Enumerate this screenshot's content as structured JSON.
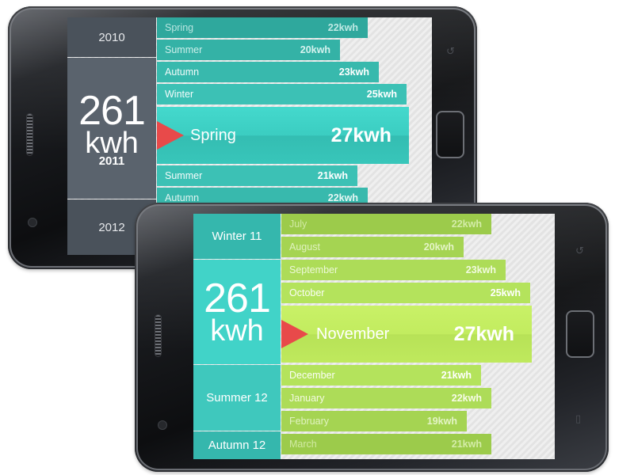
{
  "phone1": {
    "years": [
      {
        "label": "2010"
      },
      {
        "label": "2012"
      }
    ],
    "total": {
      "number": "261",
      "unit": "kwh",
      "year": "2011"
    },
    "bars": [
      {
        "label": "Spring",
        "value": "22kwh",
        "fraction": 0.6
      },
      {
        "label": "Summer",
        "value": "20kwh",
        "fraction": 0.52
      },
      {
        "label": "Autumn",
        "value": "23kwh",
        "fraction": 0.63
      },
      {
        "label": "Winter",
        "value": "25kwh",
        "fraction": 0.71
      },
      {
        "label": "Summer",
        "value": "21kwh",
        "fraction": 0.57
      },
      {
        "label": "Autumn",
        "value": "22kwh",
        "fraction": 0.6
      }
    ],
    "selected": {
      "label": "Spring",
      "value": "27kwh"
    },
    "colors": {
      "bar": "#3cbcb0",
      "bar_text": "#ffffff",
      "selected": "#3fd5c9",
      "year_bg": "#4a525b",
      "total_bg": "#5a636d",
      "marker": "#e84a4a"
    }
  },
  "phone2": {
    "seasons": [
      {
        "label": "Winter 11"
      },
      {
        "label": "Summer 12"
      },
      {
        "label": "Autumn 12"
      }
    ],
    "total": {
      "number": "261",
      "unit": "kwh"
    },
    "bars": [
      {
        "label": "July",
        "value": "22kwh",
        "fraction": 0.6
      },
      {
        "label": "August",
        "value": "20kwh",
        "fraction": 0.52
      },
      {
        "label": "September",
        "value": "23kwh",
        "fraction": 0.64
      },
      {
        "label": "October",
        "value": "25kwh",
        "fraction": 0.71
      },
      {
        "label": "December",
        "value": "21kwh",
        "fraction": 0.57
      },
      {
        "label": "January",
        "value": "22kwh",
        "fraction": 0.6
      },
      {
        "label": "February",
        "value": "19kwh",
        "fraction": 0.53
      },
      {
        "label": "March",
        "value": "21kwh",
        "fraction": 0.6
      }
    ],
    "selected": {
      "label": "November",
      "value": "27kwh"
    },
    "colors": {
      "bar": "#aee05a",
      "bar_text": "#ffffff",
      "selected": "#c8f060",
      "season_bg": "#35b7ad",
      "total_bg": "#41d3c8",
      "marker": "#e84a4a"
    }
  }
}
